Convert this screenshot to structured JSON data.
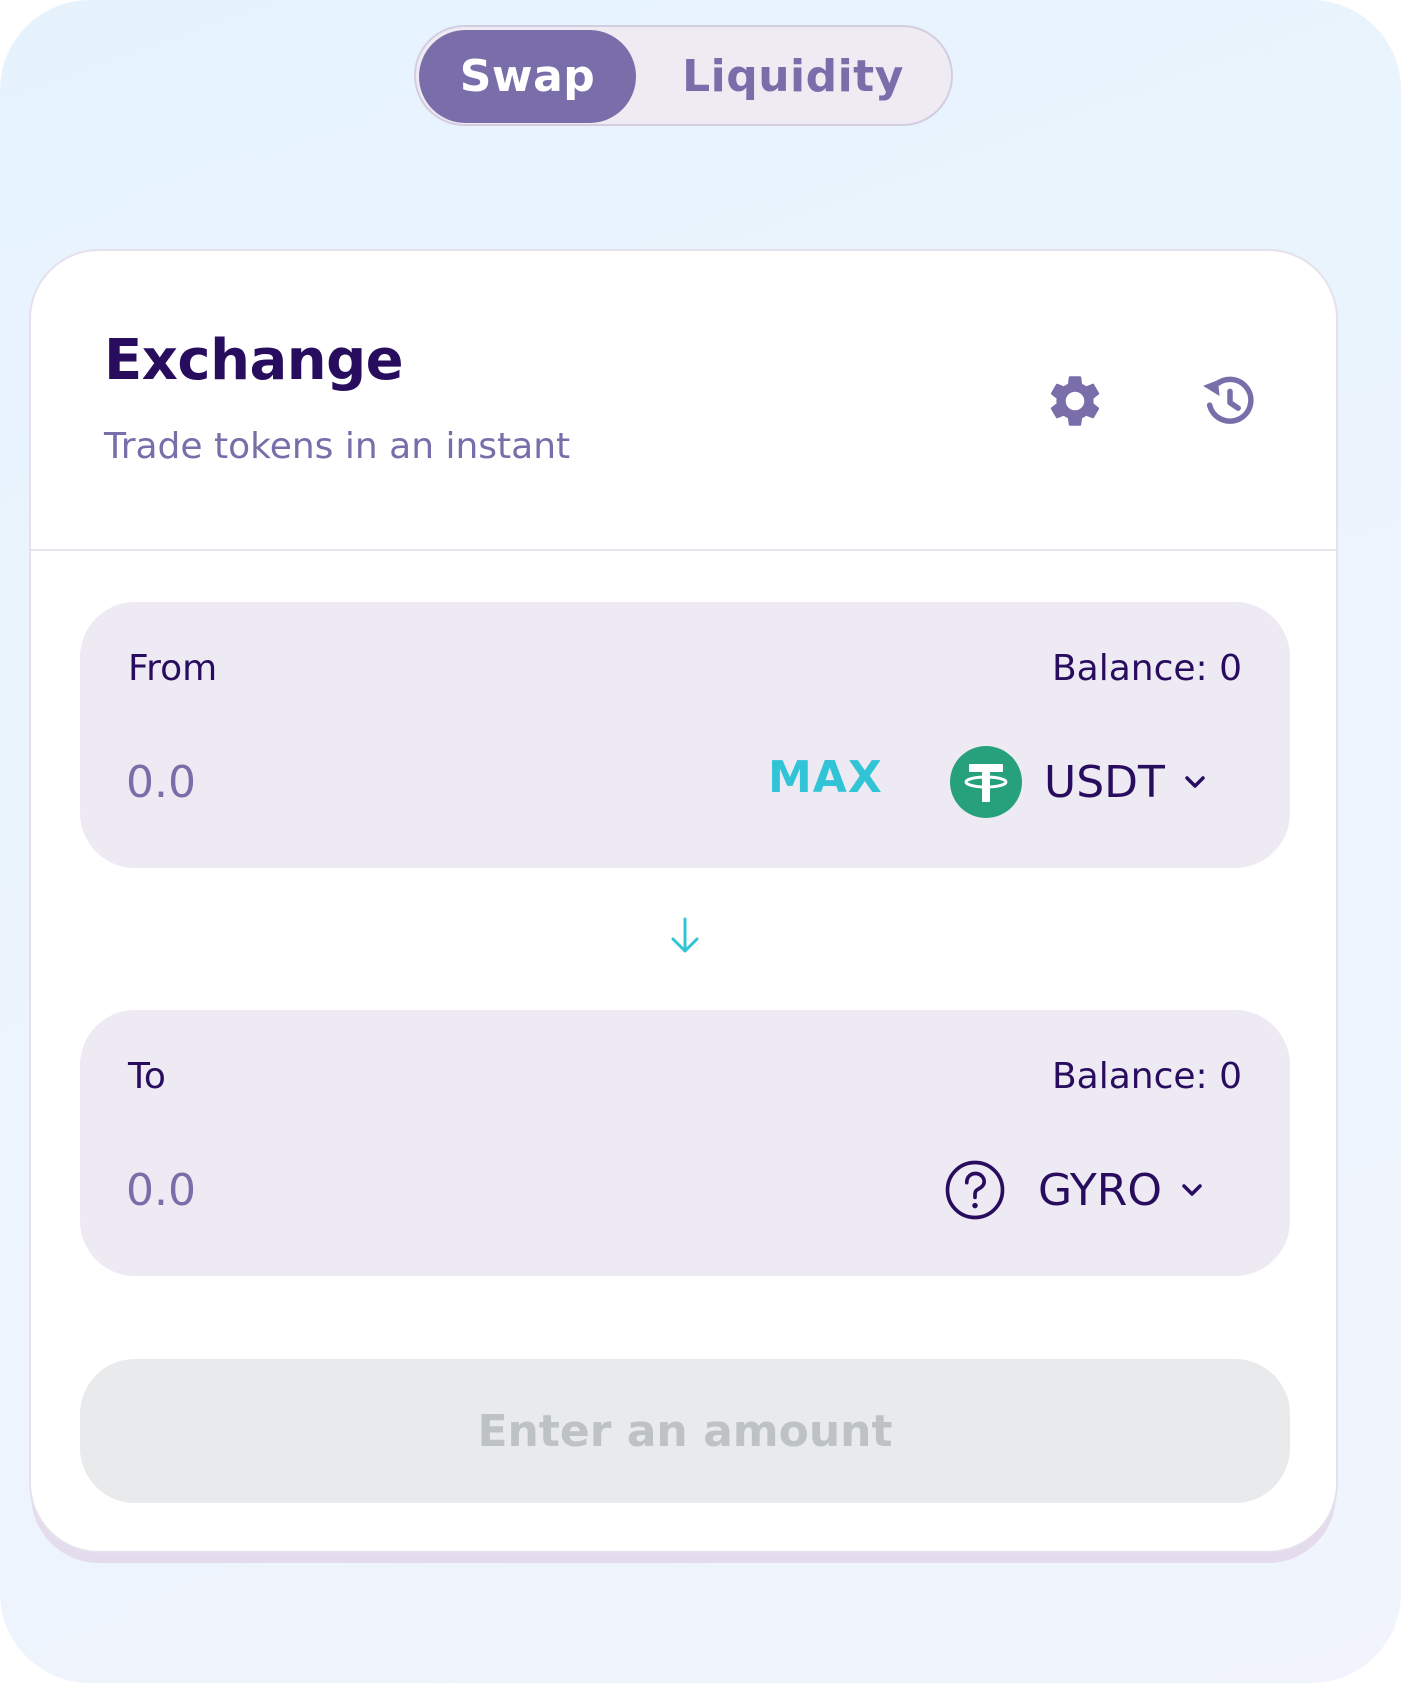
{
  "tabs": {
    "swap": "Swap",
    "liquidity": "Liquidity",
    "active": "Swap"
  },
  "header": {
    "title": "Exchange",
    "subtitle": "Trade tokens in an instant",
    "settings_icon": "gear-icon",
    "history_icon": "history-icon"
  },
  "from": {
    "label": "From",
    "balance": "Balance: 0",
    "placeholder": "0.0",
    "max_label": "MAX",
    "token": {
      "symbol": "USDT",
      "icon": "usdt-logo",
      "color": "#26a17b"
    }
  },
  "to": {
    "label": "To",
    "balance": "Balance: 0",
    "placeholder": "0.0",
    "token": {
      "symbol": "GYRO",
      "icon": "question-circle-icon"
    }
  },
  "swap_arrow_icon": "arrow-down-icon",
  "submit": {
    "label": "Enter an amount"
  },
  "colors": {
    "primary": "#7a6eaa",
    "text": "#280d5f",
    "accent": "#31c4d6",
    "disabled_bg": "#e9eaeb",
    "disabled_text": "#bdc2c4"
  }
}
